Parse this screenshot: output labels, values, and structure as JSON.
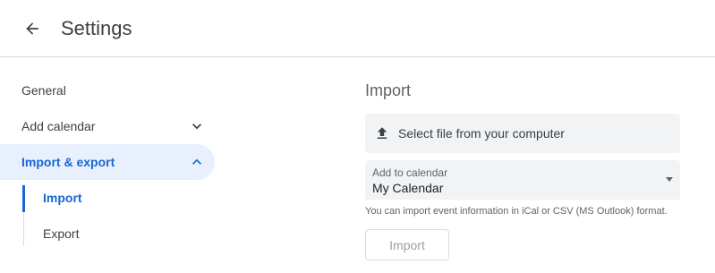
{
  "header": {
    "back_icon": "arrow-back-icon",
    "title": "Settings"
  },
  "sidebar": {
    "items": [
      {
        "label": "General"
      },
      {
        "label": "Add calendar",
        "icon": "chevron-down-icon"
      },
      {
        "label": "Import & export",
        "icon": "chevron-up-icon",
        "active": true
      }
    ],
    "sub_items": [
      {
        "label": "Import",
        "active": true
      },
      {
        "label": "Export"
      }
    ]
  },
  "main": {
    "section_title": "Import",
    "file_select": {
      "icon": "upload-icon",
      "label": "Select file from your computer"
    },
    "calendar_select": {
      "label": "Add to calendar",
      "value": "My Calendar"
    },
    "hint": "You can import event information in iCal or CSV (MS Outlook) format.",
    "import_button": "Import"
  },
  "colors": {
    "accent": "#1967d2",
    "active_bg": "#e8f0fe",
    "field_bg": "#f1f3f4",
    "divider": "#dadce0"
  }
}
